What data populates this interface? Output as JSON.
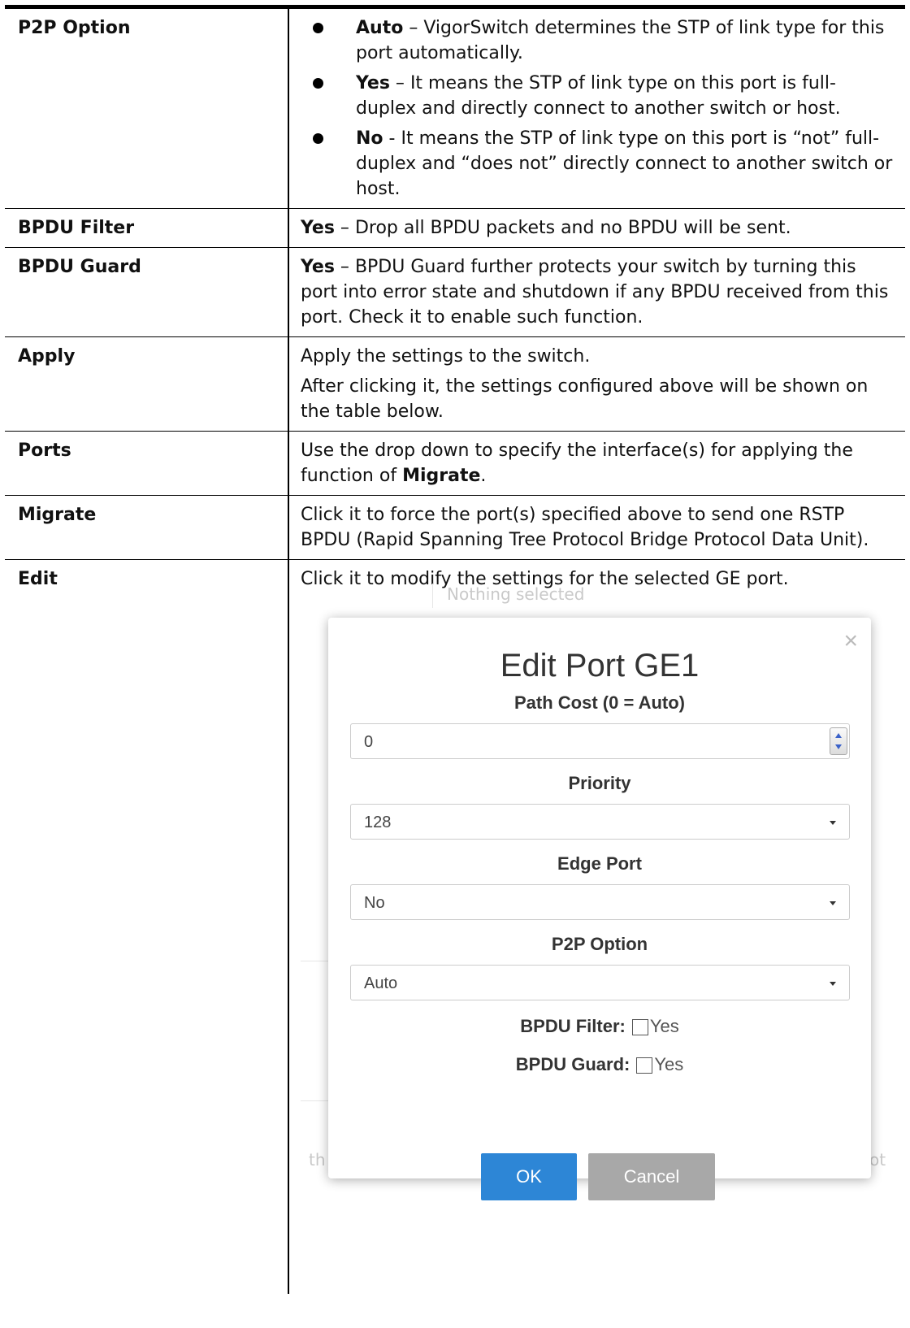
{
  "rows": [
    {
      "term": "P2P Option",
      "bullets": [
        {
          "bold": "Auto",
          "sep": " – ",
          "text": "VigorSwitch determines the STP of link type for this port automatically."
        },
        {
          "bold": "Yes",
          "sep": " – ",
          "text": "It means the STP of link type on this port is full-duplex and directly connect to another switch or host."
        },
        {
          "bold": "No",
          "sep": " - ",
          "text": "It means the STP of link type on this port is “not” full-duplex and “does not” directly connect to another switch or host."
        }
      ]
    },
    {
      "term": "BPDU Filter",
      "bold": "Yes",
      "sep": " – ",
      "text": "Drop all BPDU packets and no BPDU will be sent."
    },
    {
      "term": "BPDU Guard",
      "bold": "Yes",
      "sep": " – ",
      "text": "BPDU Guard further protects your switch by turning this port into error state and shutdown if any BPDU received from this port. Check it to enable such function."
    },
    {
      "term": "Apply",
      "para1": "Apply the settings to the switch.",
      "para2": "After clicking it, the settings configured above will be shown on the table below."
    },
    {
      "term": "Ports",
      "text_before": "Use the drop down to specify the interface(s) for applying the function of ",
      "bold": "Migrate",
      "text_after": "."
    },
    {
      "term": "Migrate",
      "text": "Click it to force the port(s) specified above to send one RSTP BPDU (Rapid Spanning Tree Protocol Bridge Protocol Data Unit)."
    },
    {
      "term": "Edit",
      "text": "Click it to modify the settings for the selected GE port."
    }
  ],
  "modal": {
    "title": "Edit Port GE1",
    "close_glyph": "×",
    "path_cost_label": "Path Cost (0 = Auto)",
    "path_cost_value": "0",
    "priority_label": "Priority",
    "priority_value": "128",
    "edge_port_label": "Edge Port",
    "edge_port_value": "No",
    "p2p_label": "P2P Option",
    "p2p_value": "Auto",
    "bpdu_filter_label": "BPDU Filter:",
    "bpdu_filter_option": "Yes",
    "bpdu_guard_label": "BPDU Guard:",
    "bpdu_guard_option": "Yes",
    "ok_label": "OK",
    "cancel_label": "Cancel",
    "ok_color": "#2d86d6",
    "cancel_color": "#a8a8a8"
  },
  "background_fragments": {
    "top_text": "Nothing selected",
    "left_fragment": "th",
    "right_fragment": "ot"
  }
}
